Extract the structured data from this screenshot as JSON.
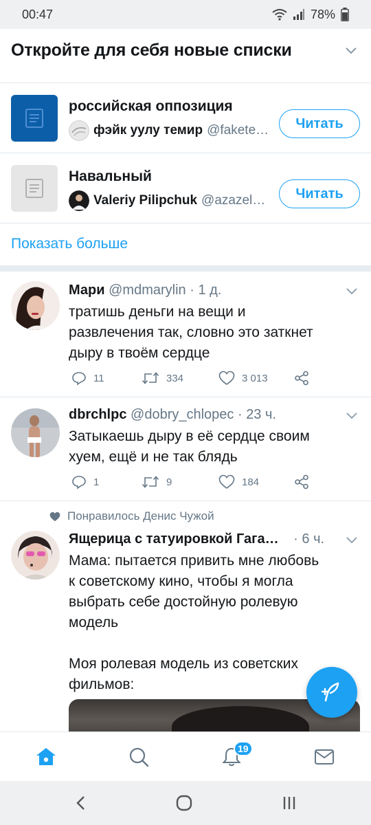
{
  "status_bar": {
    "time": "00:47",
    "battery": "78%"
  },
  "header": {
    "title": "Откройте для себя новые списки"
  },
  "lists": [
    {
      "name": "российская оппозиция",
      "owner_name": "фэйк уулу темир",
      "owner_handle": "@fakete…",
      "button": "Читать",
      "thumb_color": "#0d5ea8"
    },
    {
      "name": "Навальный",
      "owner_name": "Valeriy Pilipchuk",
      "owner_handle": "@azazel…",
      "button": "Читать",
      "thumb_color": "#e6e6e6"
    }
  ],
  "show_more": "Показать больше",
  "tweets": [
    {
      "name": "Мари",
      "handle": "@mdmarylin",
      "time": "1 д.",
      "text": "тратишь деньги на вещи и\nразвлечения так, словно это заткнет\nдыру в твоём сердце",
      "replies": "11",
      "retweets": "334",
      "likes": "3 013"
    },
    {
      "name": "dbrchlpc",
      "handle": "@dobry_chlopec",
      "time": "23 ч.",
      "text": "Затыкаешь дыру в её сердце своим\nхуем, ещё и не так блядь",
      "replies": "1",
      "retweets": "9",
      "likes": "184"
    },
    {
      "liked_by": "Понравилось Денис Чужой",
      "name": "Ящерица с татуировкой Гага…",
      "time": "6 ч.",
      "text": "Мама: пытается привить мне любовь\nк советскому кино, чтобы я могла\nвыбрать себе достойную ролевую\nмодель\n\nМоя ролевая модель из советских\nфильмов:"
    }
  ],
  "tab_bar": {
    "notifications_badge": "19"
  },
  "colors": {
    "accent": "#1da1f2",
    "text": "#14171a",
    "secondary": "#657786",
    "divider": "#e1e8ed"
  }
}
